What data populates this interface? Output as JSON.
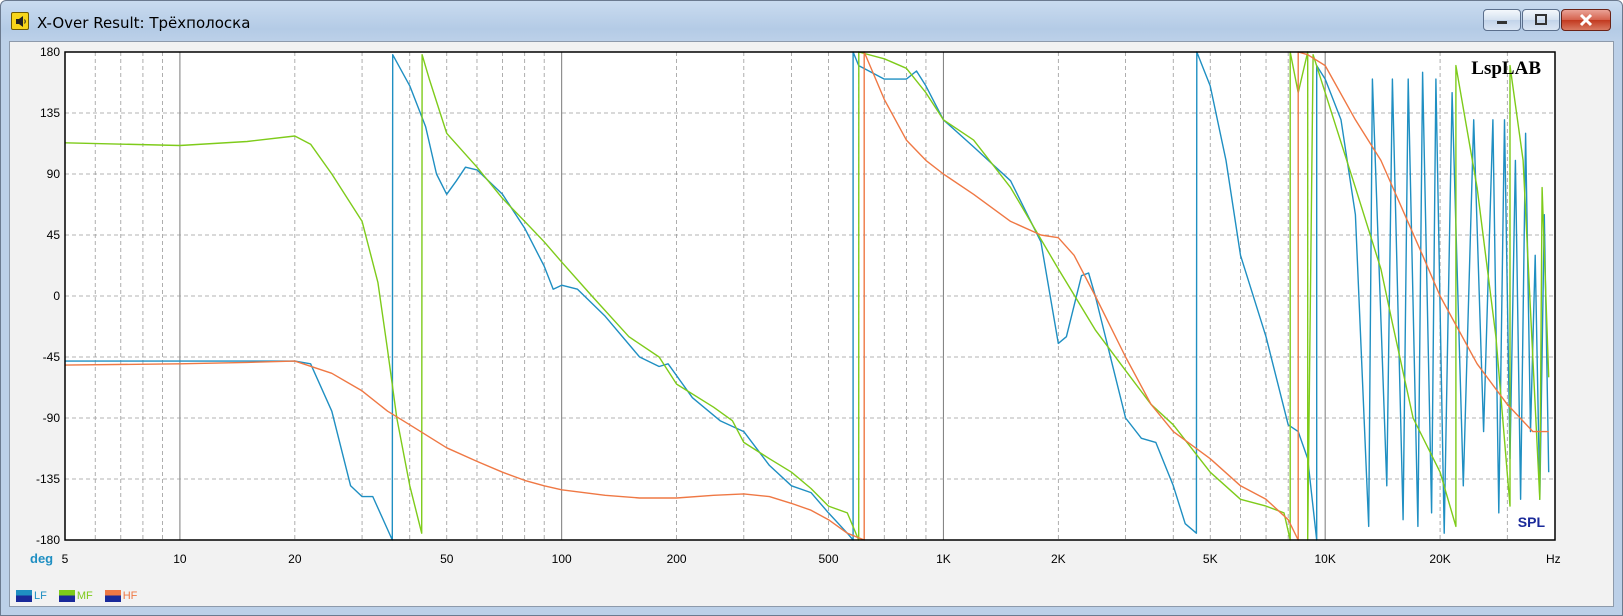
{
  "window": {
    "title": "X-Over Result: Трёхполоска",
    "icon": "speaker-icon",
    "controls": {
      "minimize": "minimize-icon",
      "maximize": "maximize-icon",
      "close": "close-icon"
    }
  },
  "chart_data": {
    "type": "line",
    "brand": "LspLAB",
    "mode_label": "SPL",
    "y_unit": "deg",
    "x_unit": "Hz",
    "xscale": "log",
    "xlim": [
      5,
      40000
    ],
    "ylim": [
      -180,
      180
    ],
    "grid": true,
    "x_ticks": [
      {
        "value": 5,
        "label": "5"
      },
      {
        "value": 10,
        "label": "10"
      },
      {
        "value": 20,
        "label": "20"
      },
      {
        "value": 50,
        "label": "50"
      },
      {
        "value": 100,
        "label": "100"
      },
      {
        "value": 200,
        "label": "200"
      },
      {
        "value": 500,
        "label": "500"
      },
      {
        "value": 1000,
        "label": "1K"
      },
      {
        "value": 2000,
        "label": "2K"
      },
      {
        "value": 5000,
        "label": "5K"
      },
      {
        "value": 10000,
        "label": "10K"
      },
      {
        "value": 20000,
        "label": "20K"
      }
    ],
    "y_ticks": [
      180,
      135,
      90,
      45,
      0,
      -45,
      -90,
      -135,
      -180
    ],
    "series": [
      {
        "name": "LF",
        "color": "#1f8fc2",
        "points": [
          [
            5,
            -48
          ],
          [
            10,
            -48
          ],
          [
            15,
            -48
          ],
          [
            20,
            -48
          ],
          [
            22,
            -50
          ],
          [
            25,
            -85
          ],
          [
            28,
            -140
          ],
          [
            30,
            -148
          ],
          [
            32,
            -148
          ],
          [
            36,
            -180
          ],
          [
            36.1,
            178
          ],
          [
            40,
            155
          ],
          [
            44,
            125
          ],
          [
            47,
            90
          ],
          [
            50,
            75
          ],
          [
            53,
            85
          ],
          [
            56,
            95
          ],
          [
            60,
            93
          ],
          [
            70,
            75
          ],
          [
            80,
            50
          ],
          [
            90,
            22
          ],
          [
            95,
            5
          ],
          [
            100,
            8
          ],
          [
            110,
            5
          ],
          [
            130,
            -15
          ],
          [
            160,
            -45
          ],
          [
            180,
            -52
          ],
          [
            190,
            -50
          ],
          [
            220,
            -75
          ],
          [
            260,
            -92
          ],
          [
            300,
            -100
          ],
          [
            350,
            -125
          ],
          [
            400,
            -140
          ],
          [
            450,
            -145
          ],
          [
            500,
            -160
          ],
          [
            560,
            -175
          ],
          [
            580,
            -180
          ],
          [
            580.1,
            180
          ],
          [
            600,
            170
          ],
          [
            700,
            160
          ],
          [
            800,
            160
          ],
          [
            850,
            166
          ],
          [
            900,
            155
          ],
          [
            1000,
            130
          ],
          [
            1200,
            110
          ],
          [
            1500,
            85
          ],
          [
            1800,
            40
          ],
          [
            2000,
            -35
          ],
          [
            2100,
            -30
          ],
          [
            2300,
            15
          ],
          [
            2400,
            17
          ],
          [
            2500,
            0
          ],
          [
            3000,
            -90
          ],
          [
            3300,
            -105
          ],
          [
            3600,
            -108
          ],
          [
            4000,
            -140
          ],
          [
            4300,
            -168
          ],
          [
            4600,
            -175
          ],
          [
            4610,
            180
          ],
          [
            5000,
            155
          ],
          [
            5500,
            100
          ],
          [
            6000,
            30
          ],
          [
            7000,
            -30
          ],
          [
            8000,
            -95
          ],
          [
            8500,
            -100
          ],
          [
            9000,
            -120
          ],
          [
            9500,
            -180
          ],
          [
            9500.1,
            170
          ],
          [
            10000,
            160
          ],
          [
            11000,
            130
          ],
          [
            12000,
            60
          ],
          [
            13000,
            -170
          ],
          [
            13300,
            160
          ],
          [
            14500,
            -140
          ],
          [
            15000,
            160
          ],
          [
            16000,
            -165
          ],
          [
            16500,
            160
          ],
          [
            17500,
            -170
          ],
          [
            18000,
            165
          ],
          [
            19000,
            -160
          ],
          [
            19500,
            160
          ],
          [
            20500,
            -175
          ],
          [
            21500,
            150
          ],
          [
            23000,
            -140
          ],
          [
            24500,
            130
          ],
          [
            26000,
            -100
          ],
          [
            27500,
            130
          ],
          [
            28500,
            -160
          ],
          [
            29500,
            130
          ],
          [
            30500,
            -120
          ],
          [
            31500,
            100
          ],
          [
            32500,
            -150
          ],
          [
            33500,
            120
          ],
          [
            34500,
            -100
          ],
          [
            35500,
            30
          ],
          [
            36500,
            -150
          ],
          [
            37500,
            60
          ],
          [
            38500,
            -130
          ]
        ]
      },
      {
        "name": "MF",
        "color": "#7ecb1a",
        "points": [
          [
            5,
            113
          ],
          [
            10,
            111
          ],
          [
            15,
            114
          ],
          [
            20,
            118
          ],
          [
            22,
            112
          ],
          [
            25,
            90
          ],
          [
            30,
            55
          ],
          [
            33,
            10
          ],
          [
            35,
            -40
          ],
          [
            37,
            -90
          ],
          [
            40,
            -140
          ],
          [
            43,
            -175
          ],
          [
            43.1,
            178
          ],
          [
            45,
            160
          ],
          [
            50,
            120
          ],
          [
            60,
            95
          ],
          [
            70,
            72
          ],
          [
            80,
            55
          ],
          [
            90,
            40
          ],
          [
            100,
            25
          ],
          [
            120,
            0
          ],
          [
            150,
            -30
          ],
          [
            180,
            -45
          ],
          [
            200,
            -65
          ],
          [
            250,
            -82
          ],
          [
            280,
            -92
          ],
          [
            300,
            -108
          ],
          [
            350,
            -120
          ],
          [
            400,
            -130
          ],
          [
            450,
            -142
          ],
          [
            500,
            -155
          ],
          [
            560,
            -160
          ],
          [
            600,
            -180
          ],
          [
            600.1,
            180
          ],
          [
            700,
            175
          ],
          [
            800,
            168
          ],
          [
            900,
            150
          ],
          [
            1000,
            130
          ],
          [
            1200,
            115
          ],
          [
            1500,
            80
          ],
          [
            2000,
            20
          ],
          [
            2500,
            -25
          ],
          [
            3000,
            -55
          ],
          [
            3500,
            -80
          ],
          [
            4000,
            -95
          ],
          [
            5000,
            -130
          ],
          [
            6000,
            -150
          ],
          [
            7000,
            -155
          ],
          [
            7800,
            -160
          ],
          [
            8100,
            -180
          ],
          [
            8100.1,
            180
          ],
          [
            8500,
            150
          ],
          [
            9000,
            180
          ],
          [
            9000.1,
            -180
          ],
          [
            9300,
            178
          ],
          [
            10000,
            150
          ],
          [
            12000,
            80
          ],
          [
            14000,
            20
          ],
          [
            15000,
            -20
          ],
          [
            17000,
            -90
          ],
          [
            20000,
            -130
          ],
          [
            22000,
            -170
          ],
          [
            22000.1,
            170
          ],
          [
            25000,
            80
          ],
          [
            28000,
            -30
          ],
          [
            30500,
            -155
          ],
          [
            30500.1,
            170
          ],
          [
            33000,
            100
          ],
          [
            36500,
            -150
          ],
          [
            37000,
            80
          ],
          [
            38500,
            -60
          ]
        ]
      },
      {
        "name": "HF",
        "color": "#ef7844",
        "points": [
          [
            5,
            -51
          ],
          [
            10,
            -50
          ],
          [
            15,
            -49
          ],
          [
            20,
            -48
          ],
          [
            25,
            -57
          ],
          [
            30,
            -70
          ],
          [
            35,
            -85
          ],
          [
            40,
            -95
          ],
          [
            50,
            -112
          ],
          [
            60,
            -122
          ],
          [
            70,
            -130
          ],
          [
            80,
            -136
          ],
          [
            90,
            -140
          ],
          [
            100,
            -143
          ],
          [
            130,
            -147
          ],
          [
            160,
            -149
          ],
          [
            200,
            -149
          ],
          [
            250,
            -147
          ],
          [
            300,
            -146
          ],
          [
            350,
            -148
          ],
          [
            400,
            -153
          ],
          [
            450,
            -158
          ],
          [
            500,
            -165
          ],
          [
            560,
            -175
          ],
          [
            620,
            -180
          ],
          [
            620.1,
            180
          ],
          [
            700,
            145
          ],
          [
            800,
            115
          ],
          [
            900,
            100
          ],
          [
            1000,
            90
          ],
          [
            1200,
            75
          ],
          [
            1500,
            55
          ],
          [
            1800,
            45
          ],
          [
            2000,
            43
          ],
          [
            2200,
            30
          ],
          [
            2500,
            0
          ],
          [
            3000,
            -45
          ],
          [
            3500,
            -80
          ],
          [
            4000,
            -100
          ],
          [
            5000,
            -120
          ],
          [
            6000,
            -140
          ],
          [
            7000,
            -150
          ],
          [
            8000,
            -165
          ],
          [
            8500,
            -180
          ],
          [
            8500.1,
            180
          ],
          [
            9000,
            178
          ],
          [
            10000,
            170
          ],
          [
            12000,
            130
          ],
          [
            14000,
            100
          ],
          [
            18000,
            30
          ],
          [
            20000,
            0
          ],
          [
            25000,
            -50
          ],
          [
            30000,
            -80
          ],
          [
            35000,
            -100
          ],
          [
            38500,
            -100
          ]
        ]
      }
    ]
  }
}
